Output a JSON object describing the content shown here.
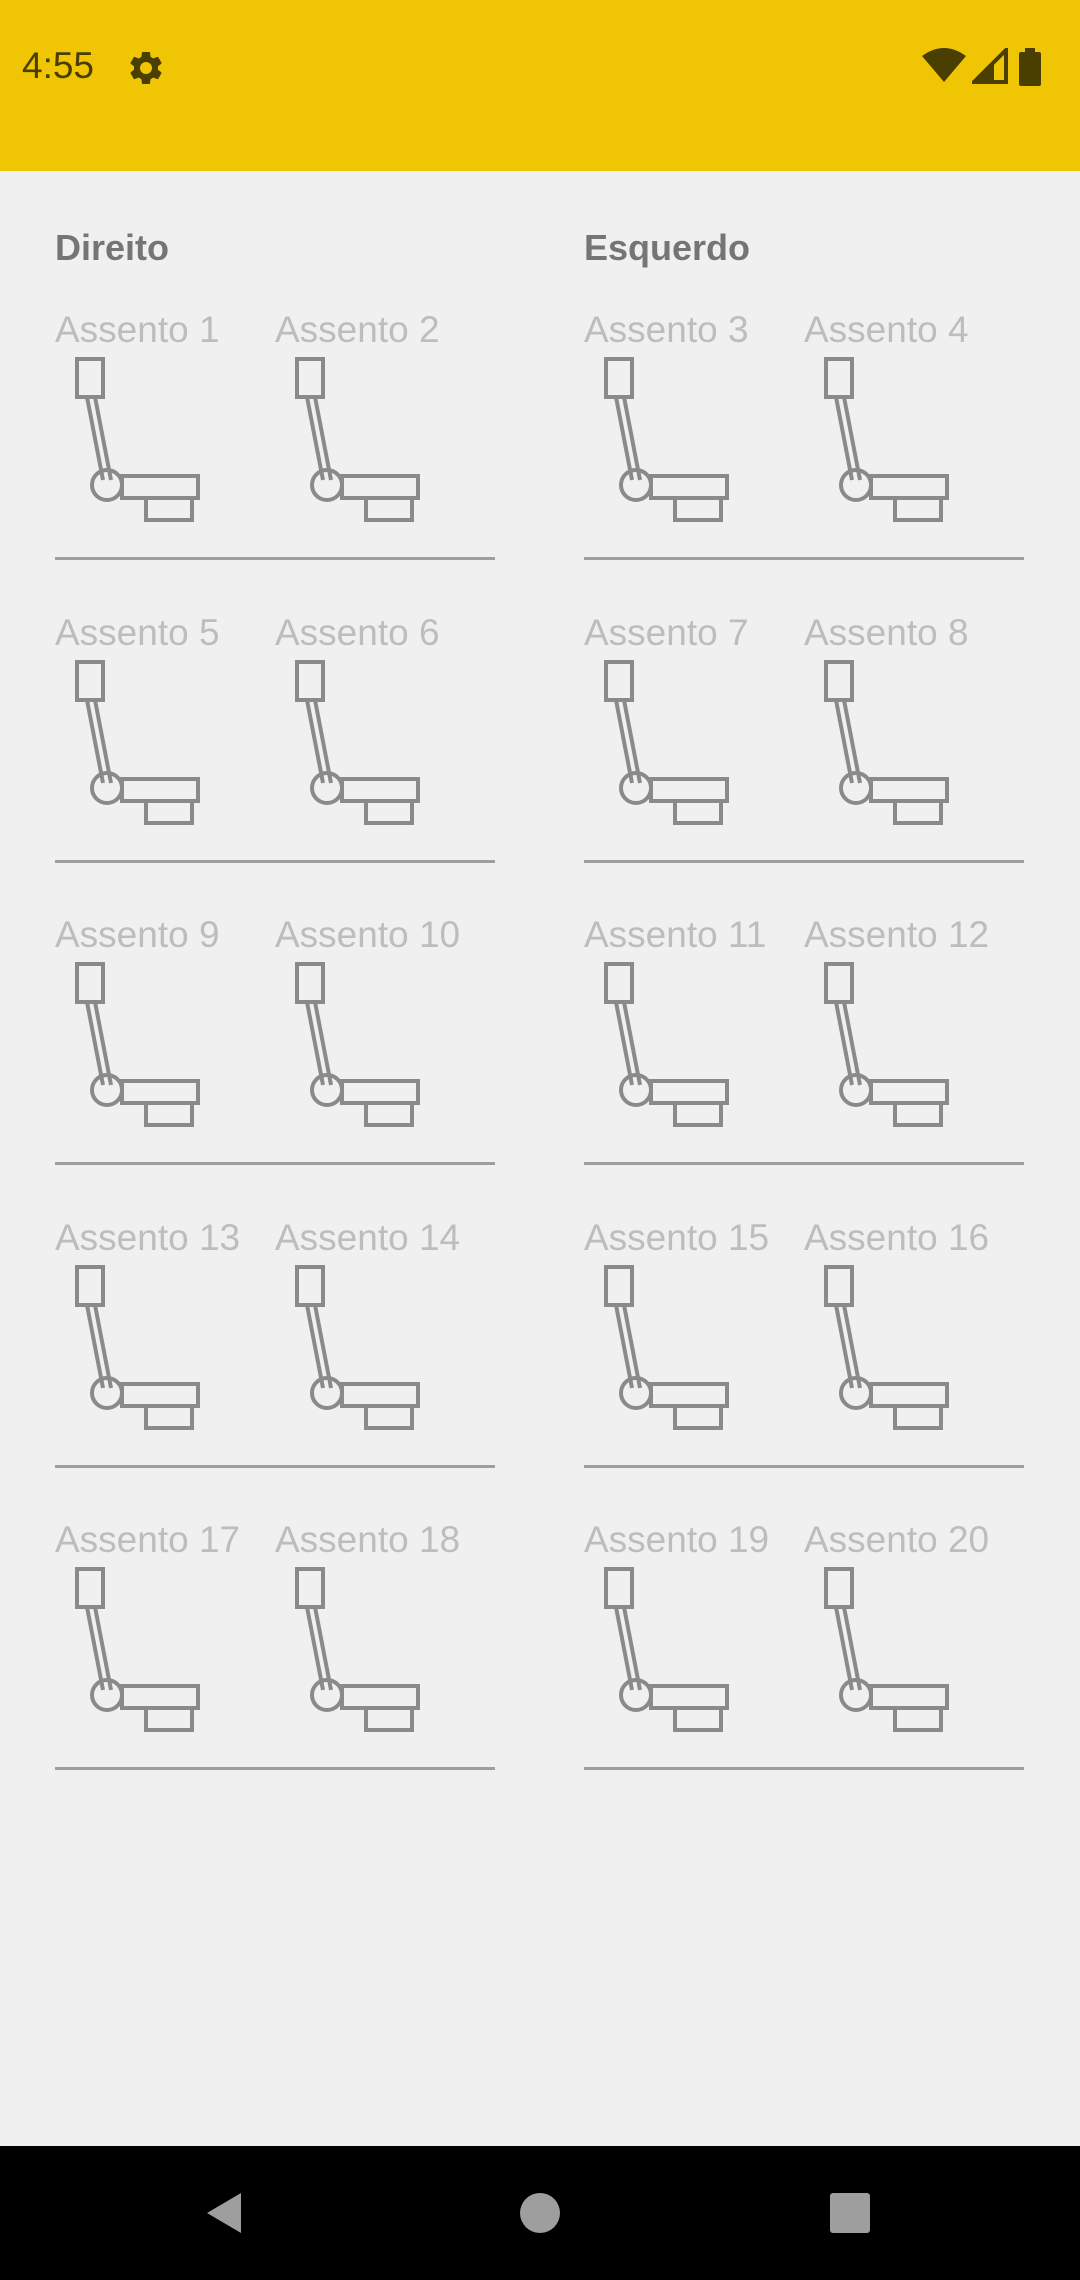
{
  "status_bar": {
    "time": "4:55",
    "icons": [
      "settings-gear-icon",
      "wifi-icon",
      "cell-signal-icon",
      "battery-icon"
    ]
  },
  "columns": {
    "left_title": "Direito",
    "right_title": "Esquerdo"
  },
  "rows": [
    {
      "seats": [
        "Assento 1",
        "Assento 2",
        "Assento 3",
        "Assento 4"
      ]
    },
    {
      "seats": [
        "Assento 5",
        "Assento 6",
        "Assento 7",
        "Assento 8"
      ]
    },
    {
      "seats": [
        "Assento 9",
        "Assento 10",
        "Assento 11",
        "Assento 12"
      ]
    },
    {
      "seats": [
        "Assento 13",
        "Assento 14",
        "Assento 15",
        "Assento 16"
      ]
    },
    {
      "seats": [
        "Assento 17",
        "Assento 18",
        "Assento 19",
        "Assento 20"
      ]
    }
  ],
  "colors": {
    "status_bar": "#f0c504",
    "background": "#f0f0f0",
    "seat_label": "#bdbdbd",
    "seat_icon": "#8a8a8a",
    "column_title": "#757575",
    "divider": "#9e9e9e"
  },
  "nav_bar": {
    "icons": [
      "back-icon",
      "home-icon",
      "recents-icon"
    ]
  }
}
